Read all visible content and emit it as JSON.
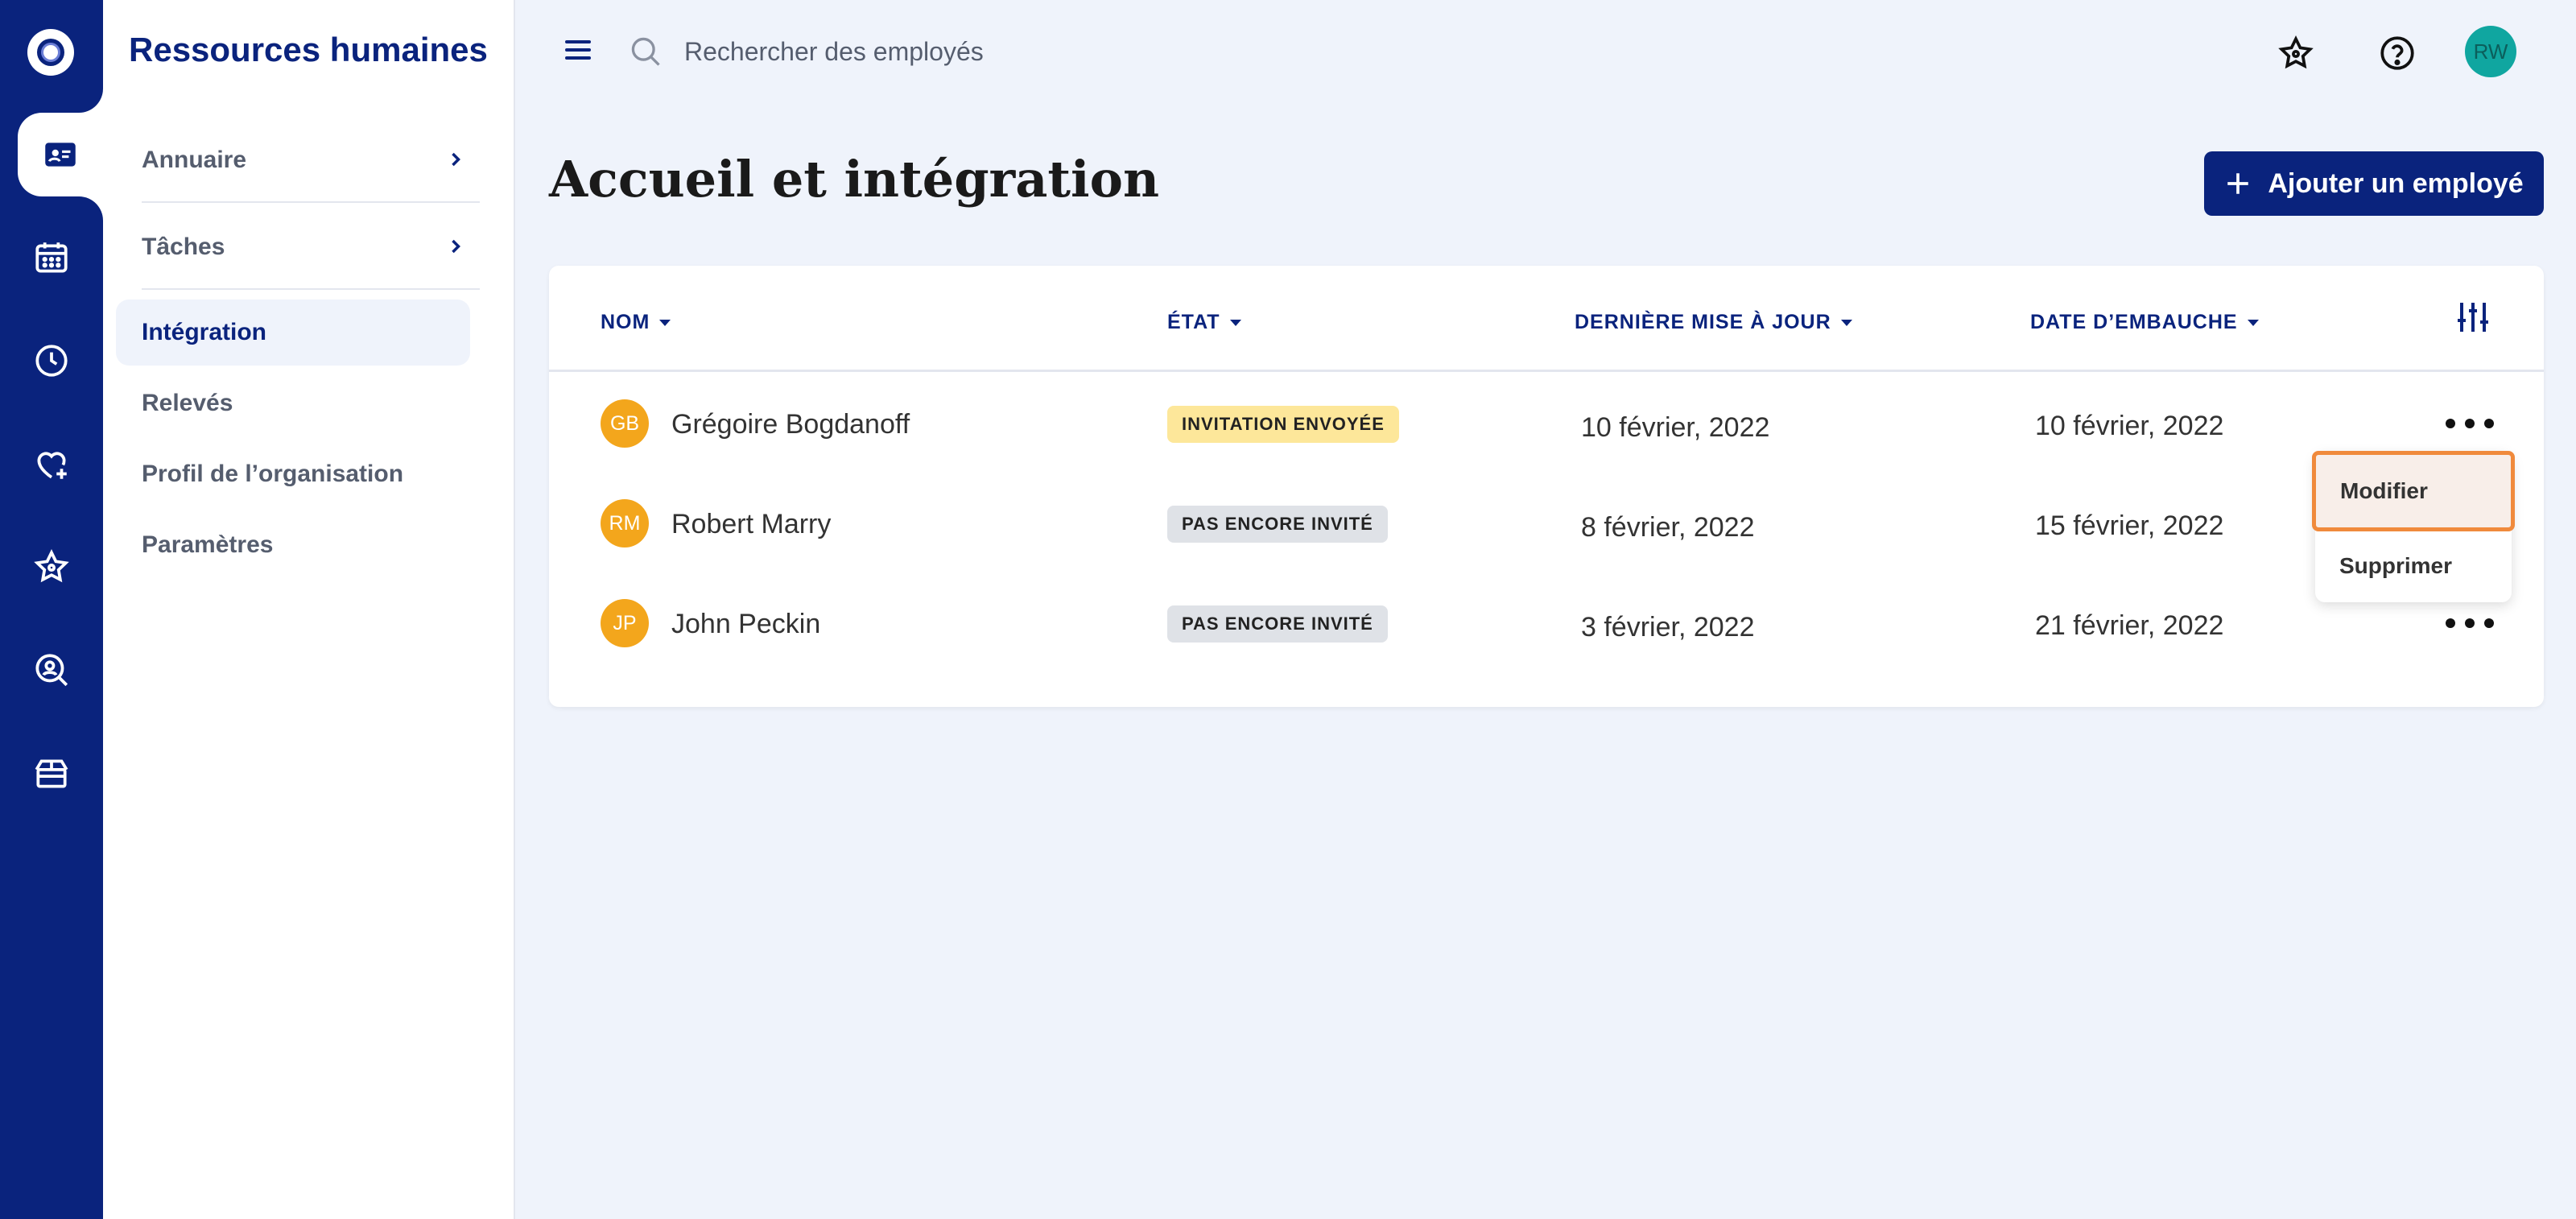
{
  "app": {
    "section_title": "Ressources humaines",
    "user_initials": "RW"
  },
  "rail": {
    "items": [
      {
        "icon": "logo-icon"
      },
      {
        "icon": "contact-card-icon",
        "active": true
      },
      {
        "icon": "calendar-icon"
      },
      {
        "icon": "clock-icon"
      },
      {
        "icon": "heart-plus-icon"
      },
      {
        "icon": "star-icon"
      },
      {
        "icon": "person-search-icon"
      },
      {
        "icon": "gift-icon"
      }
    ]
  },
  "sidebar": {
    "items": [
      {
        "label": "Annuaire",
        "has_chevron": true
      },
      {
        "label": "Tâches",
        "has_chevron": true
      },
      {
        "label": "Intégration",
        "active": true
      },
      {
        "label": "Relevés"
      },
      {
        "label": "Profil de l’organisation"
      },
      {
        "label": "Paramètres"
      }
    ]
  },
  "search": {
    "placeholder": "Rechercher des employés"
  },
  "page": {
    "title": "Accueil et intégration",
    "add_button": "Ajouter un employé"
  },
  "table": {
    "headers": {
      "name": "NOM",
      "state": "ÉTAT",
      "updated": "DERNIÈRE MISE À JOUR",
      "hired": "DATE D’EMBAUCHE"
    },
    "rows": [
      {
        "initials": "GB",
        "name": "Grégoire Bogdanoff",
        "state": "INVITATION ENVOYÉE",
        "state_kind": "sent",
        "updated": "10 février, 2022",
        "hired": "10 février, 2022"
      },
      {
        "initials": "RM",
        "name": "Robert Marry",
        "state": "PAS ENCORE INVITÉ",
        "state_kind": "not",
        "updated": "8 février, 2022",
        "hired": "15 février, 2022"
      },
      {
        "initials": "JP",
        "name": "John Peckin",
        "state": "PAS ENCORE INVITÉ",
        "state_kind": "not",
        "updated": "3 février, 2022",
        "hired": "21 février, 2022"
      }
    ]
  },
  "row_menu": {
    "items": [
      "Modifier",
      "Supprimer"
    ]
  },
  "colors": {
    "brand": "#0a237d",
    "avatar": "#f3a61c",
    "badge_sent": "#fde79a",
    "badge_not": "#dfe2e7",
    "focus": "#f08a3c"
  }
}
